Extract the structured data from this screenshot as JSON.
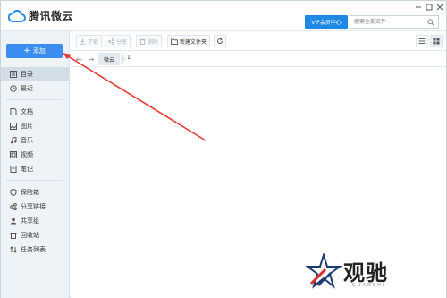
{
  "app": {
    "title": "腾讯微云",
    "vip_label": "VIP会员中心",
    "search_placeholder": "搜索全部文件",
    "window_controls": [
      "minimize-icon",
      "maximize-icon",
      "close-icon"
    ]
  },
  "colors": {
    "accent": "#1e88e5",
    "add_button": "#3b8df0",
    "sidebar_bg": "#eef3f8",
    "annotation_arrow": "#e53935"
  },
  "sidebar": {
    "add_label": "添加",
    "items": [
      {
        "label": "目录",
        "icon": "directory-icon",
        "active": true
      },
      {
        "label": "最近",
        "icon": "clock-icon",
        "active": false
      },
      {
        "label": "文档",
        "icon": "document-icon",
        "active": false
      },
      {
        "label": "图片",
        "icon": "image-icon",
        "active": false
      },
      {
        "label": "音乐",
        "icon": "music-icon",
        "active": false
      },
      {
        "label": "视频",
        "icon": "video-icon",
        "active": false
      },
      {
        "label": "笔记",
        "icon": "note-icon",
        "active": false
      },
      {
        "label": "保险箱",
        "icon": "safe-icon",
        "active": false
      },
      {
        "label": "分享链接",
        "icon": "share-link-icon",
        "active": false
      },
      {
        "label": "共享组",
        "icon": "group-icon",
        "active": false
      },
      {
        "label": "回收站",
        "icon": "trash-icon",
        "active": false
      },
      {
        "label": "任务列表",
        "icon": "task-list-icon",
        "active": false
      }
    ]
  },
  "toolbar": {
    "download_label": "下载",
    "share_label": "分享",
    "delete_label": "删除",
    "new_folder_label": "新建文件夹"
  },
  "breadcrumb": {
    "current": "微云",
    "count": "1"
  },
  "watermark": {
    "text": "观驰",
    "subtext": "GUANCHI"
  }
}
